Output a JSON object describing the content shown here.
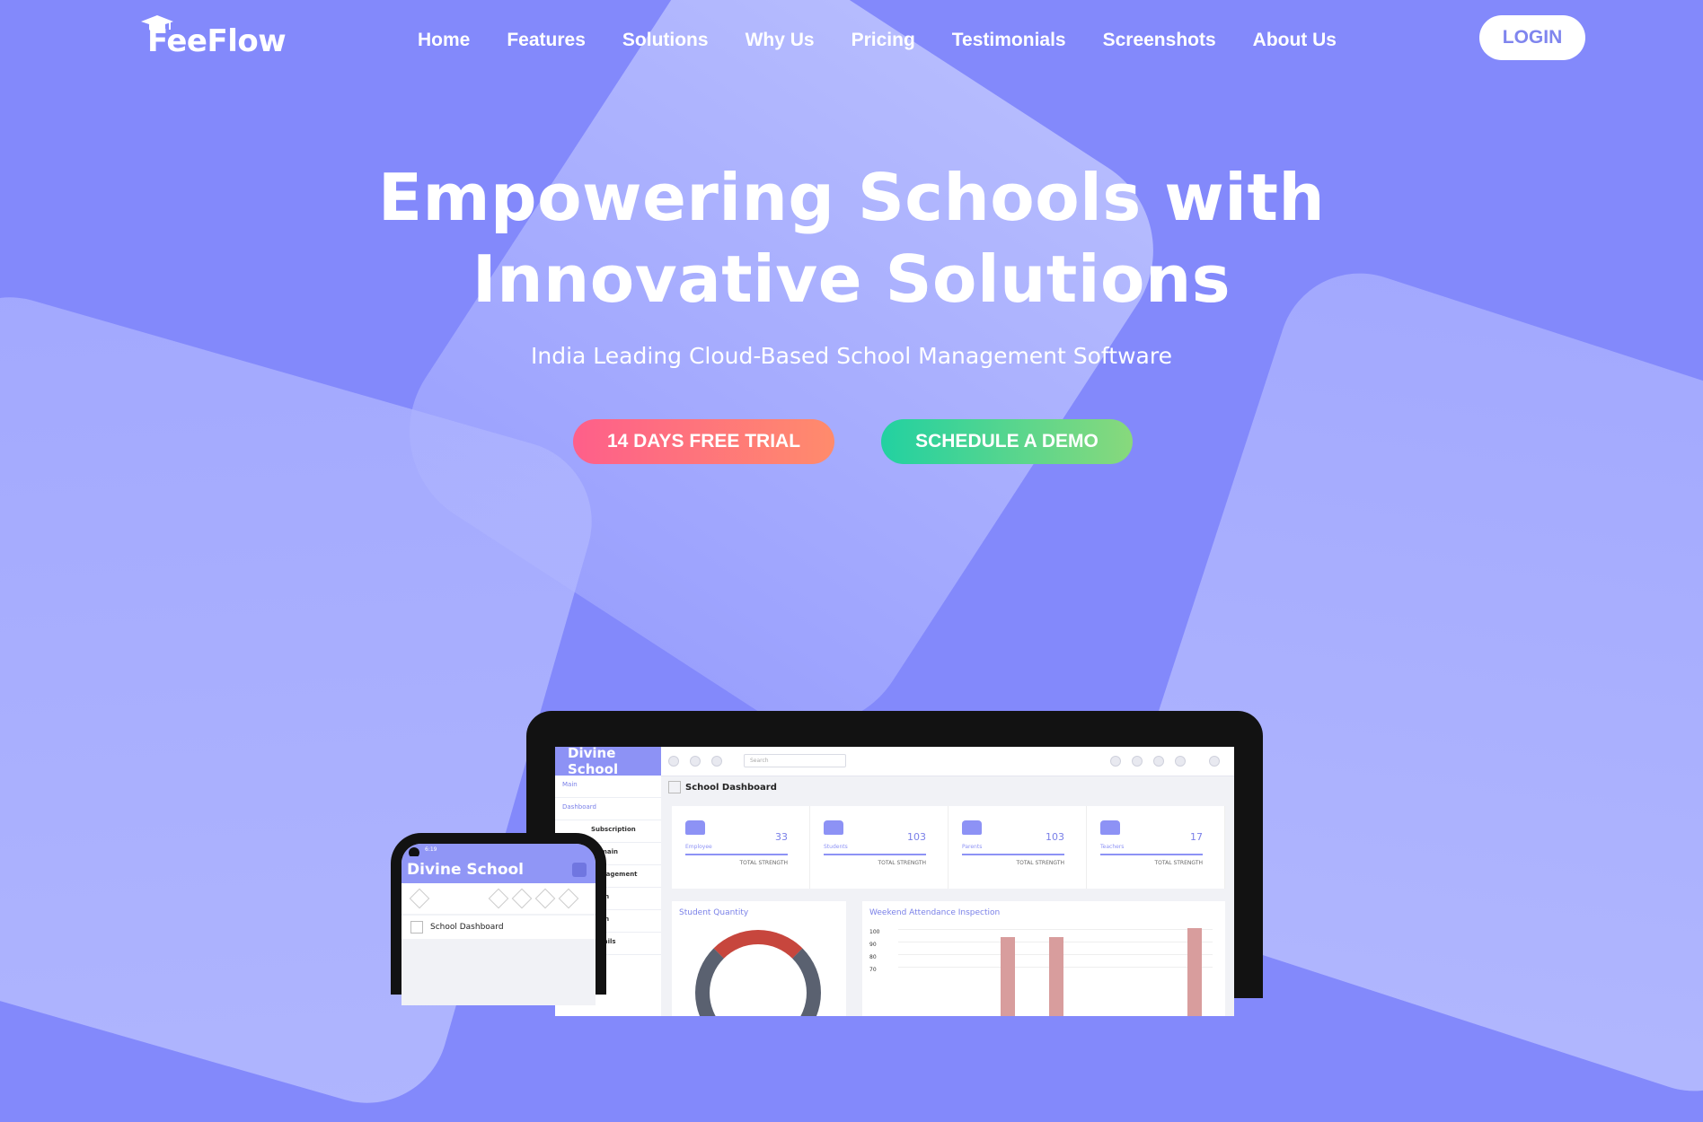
{
  "brand": {
    "name": "FeeFlow",
    "icon": "graduation-cap-icon"
  },
  "nav": {
    "links": [
      "Home",
      "Features",
      "Solutions",
      "Why Us",
      "Pricing",
      "Testimonials",
      "Screenshots",
      "About Us"
    ],
    "login_label": "LOGIN"
  },
  "hero": {
    "title_line1": "Empowering Schools with",
    "title_line2": "Innovative Solutions",
    "subtitle": "India Leading Cloud-Based School Management Software",
    "cta_trial": "14 DAYS FREE TRIAL",
    "cta_demo": "SCHEDULE A DEMO"
  },
  "colors": {
    "background": "#8389fb",
    "trial_gradient": [
      "#fe5f8a",
      "#ff8b6c"
    ],
    "demo_gradient": [
      "#22d1a1",
      "#88d97c"
    ],
    "login_text": "#7f85ee"
  },
  "dashboard_preview": {
    "school_name": "Divine School",
    "sidebar": [
      "Main",
      "Dashboard",
      "Subscription",
      "Domain",
      "Management",
      "...ion",
      "...ion",
      "Details"
    ],
    "search_placeholder": "Search",
    "page_title": "School Dashboard",
    "stats": [
      {
        "label": "Employee",
        "value": "33",
        "caption": "TOTAL STRENGTH"
      },
      {
        "label": "Students",
        "value": "103",
        "caption": "TOTAL STRENGTH"
      },
      {
        "label": "Parents",
        "value": "103",
        "caption": "TOTAL STRENGTH"
      },
      {
        "label": "Teachers",
        "value": "17",
        "caption": "TOTAL STRENGTH"
      }
    ],
    "panels": [
      "Student Quantity",
      "Weekend Attendance Inspection"
    ],
    "y_ticks": [
      "100",
      "90",
      "80",
      "70"
    ]
  },
  "phone_preview": {
    "status_time": "6:19",
    "school_name": "Divine School",
    "page_title": "School Dashboard"
  }
}
